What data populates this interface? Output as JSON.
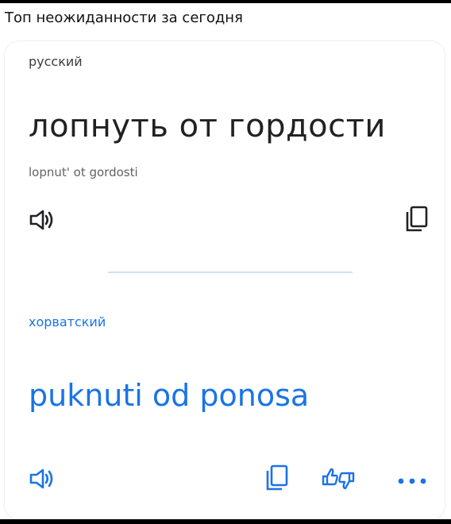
{
  "caption": "Топ неожиданности за сегодня",
  "source": {
    "language": "русский",
    "text": "лопнуть от гордости",
    "transliteration": "lopnut' ot gordosti"
  },
  "target": {
    "language": "хорватский",
    "text": "puknuti od ponosa"
  },
  "icons": {
    "source_speaker": "speaker-icon",
    "source_copy": "copy-icon",
    "target_speaker": "speaker-icon",
    "target_copy": "copy-icon",
    "feedback": "thumbs-feedback-icon",
    "more": "more-dots-icon"
  },
  "colors": {
    "accent": "#1a73e8",
    "text": "#202124",
    "muted": "#5f6368",
    "divider": "#cfe1f7"
  }
}
